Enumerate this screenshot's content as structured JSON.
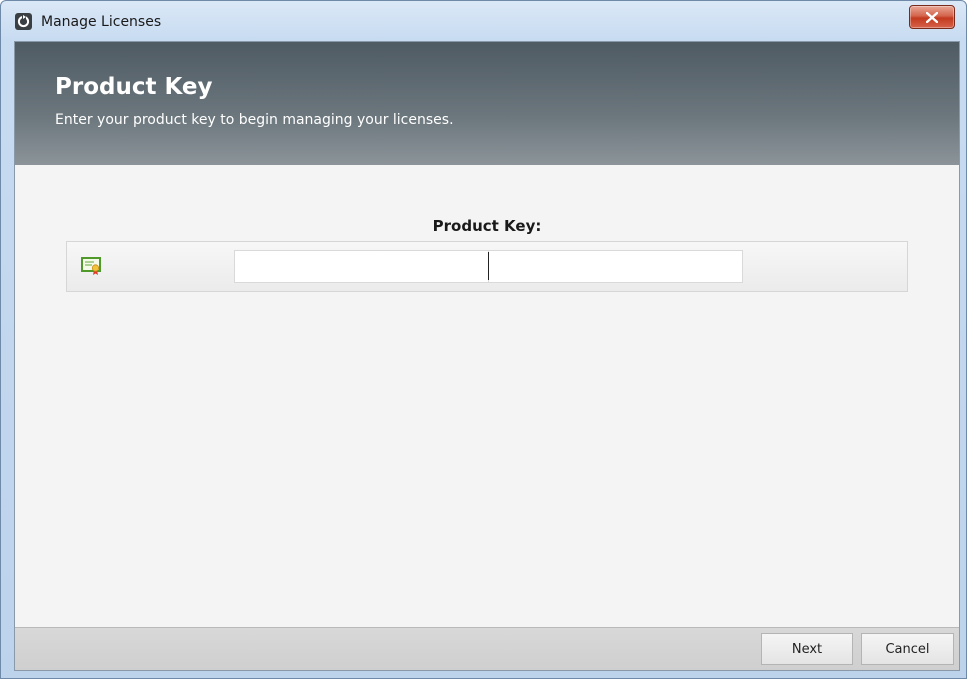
{
  "window": {
    "title": "Manage Licenses",
    "app_icon": "app-logo-icon",
    "close_icon": "close-icon"
  },
  "header": {
    "title": "Product Key",
    "subtitle": "Enter your product key to begin managing your licenses."
  },
  "product_key": {
    "label": "Product Key:",
    "icon": "certificate-icon",
    "part1_value": "",
    "part2_value": ""
  },
  "footer": {
    "next_label": "Next",
    "cancel_label": "Cancel"
  },
  "colors": {
    "header_dark": "#4f5b63",
    "header_light": "#8c9499",
    "close_red": "#c23a1f",
    "content_bg": "#f4f4f4"
  }
}
